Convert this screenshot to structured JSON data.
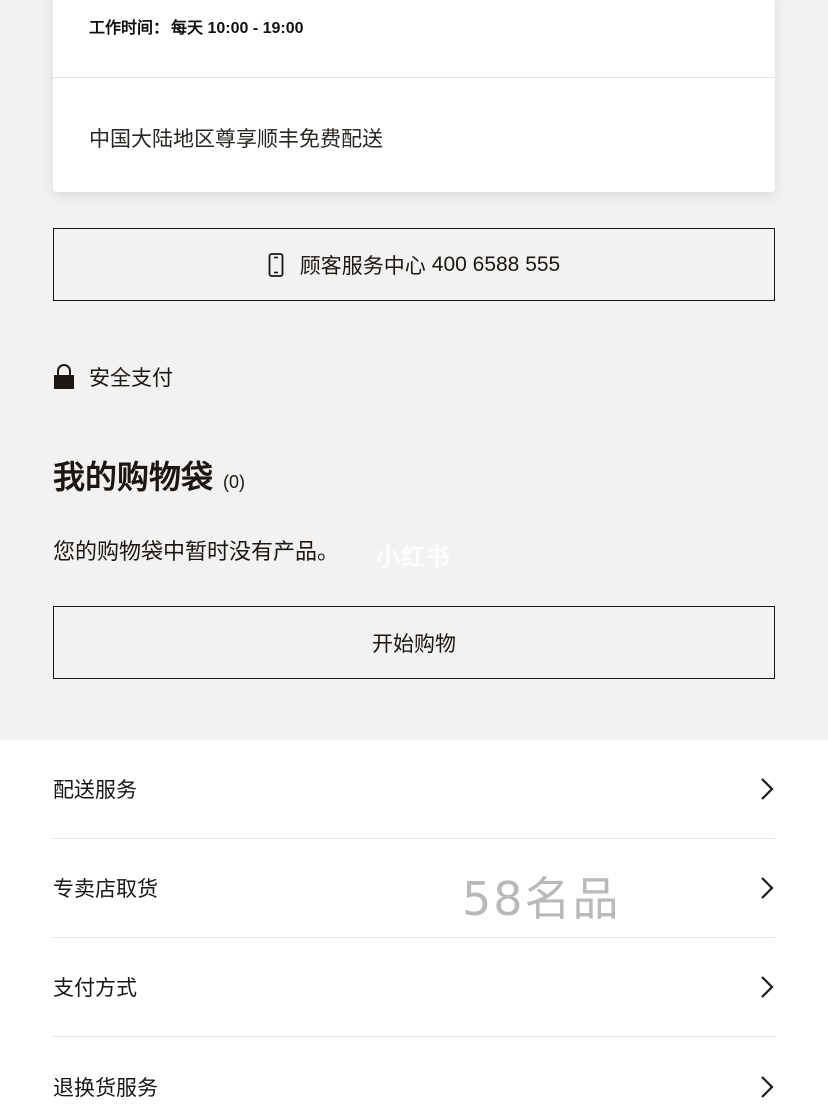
{
  "store_info": {
    "hours_label": "工作时间：",
    "hours_value": "每天 10:00 - 19:00",
    "shipping_note": "中国大陆地区尊享顺丰免费配送"
  },
  "customer_service": {
    "label": "顾客服务中心",
    "phone": "400 6588 555",
    "icon": "phone-icon"
  },
  "secure_payment": {
    "label": "安全支付",
    "icon": "lock-icon"
  },
  "bag": {
    "title": "我的购物袋",
    "count": "(0)",
    "empty_message": "您的购物袋中暂时没有产品。",
    "start_button": "开始购物"
  },
  "services": [
    {
      "label": "配送服务",
      "icon": "chevron-right-icon"
    },
    {
      "label": "专卖店取货",
      "icon": "chevron-right-icon"
    },
    {
      "label": "支付方式",
      "icon": "chevron-right-icon"
    },
    {
      "label": "退换货服务",
      "icon": "chevron-right-icon"
    }
  ],
  "watermarks": {
    "top": "小红书",
    "bottom": "58名品"
  },
  "colors": {
    "background": "#f3f2f0",
    "text": "#1a1714",
    "card": "#ffffff",
    "divider": "#e4e2df"
  }
}
